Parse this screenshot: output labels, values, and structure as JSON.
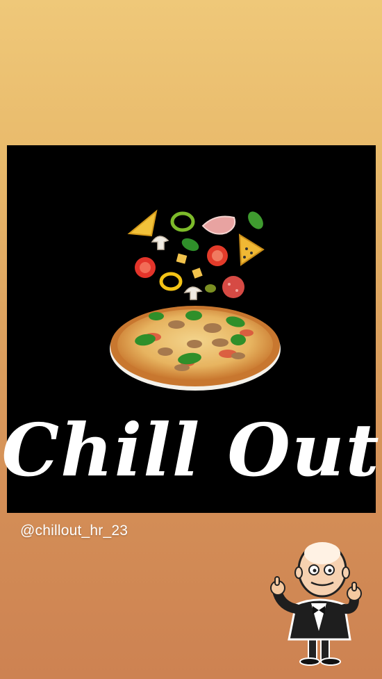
{
  "brand": {
    "logo_text": "Chill Out"
  },
  "profile": {
    "handle": "@chillout_hr_23"
  },
  "icons": {
    "food_photo": "pizza-with-toppings-illustration",
    "mascot": "waiter-thumbs-up-icon"
  },
  "colors": {
    "background_top": "#efc879",
    "background_bottom": "#cd8252",
    "card": "#000000",
    "text": "#ffffff"
  }
}
